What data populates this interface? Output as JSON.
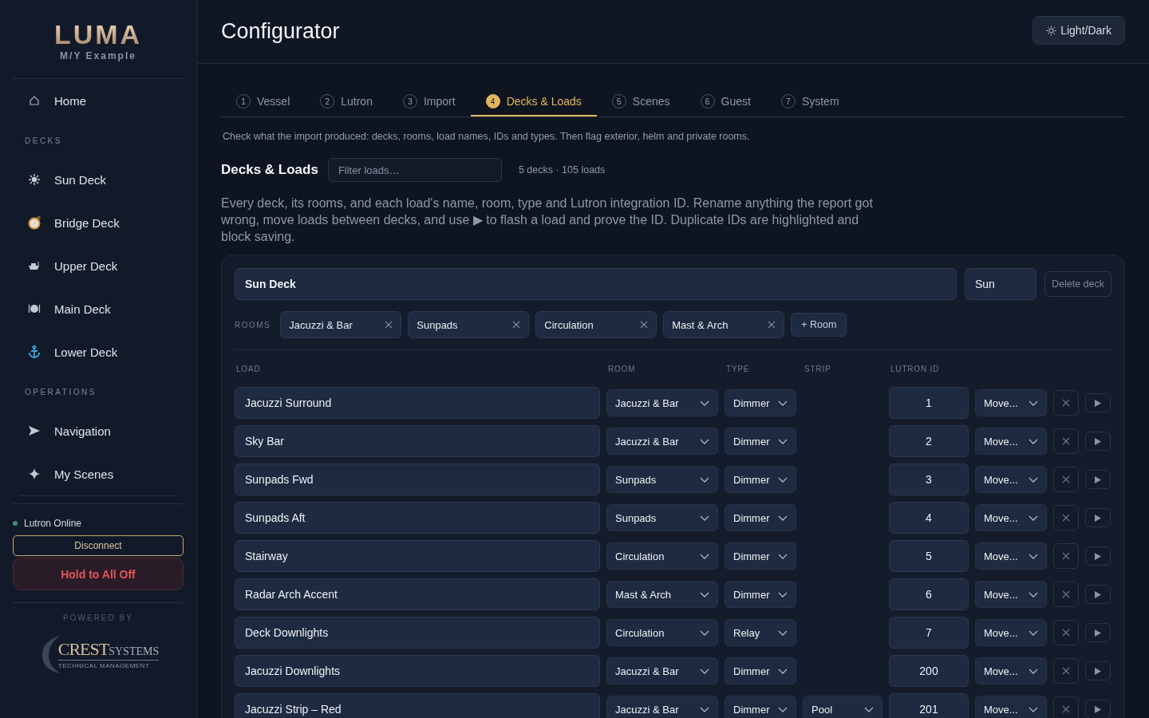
{
  "sidebar": {
    "logo": "LUMA",
    "vessel": "M/Y Example",
    "sections": [
      {
        "items": [
          {
            "label": "Home",
            "kind": "home"
          }
        ]
      },
      {
        "title": "DECKS",
        "items": [
          {
            "label": "Sun Deck",
            "kind": "sun"
          },
          {
            "label": "Bridge Deck",
            "kind": "compass"
          },
          {
            "label": "Upper Deck",
            "kind": "boat"
          },
          {
            "label": "Main Deck",
            "kind": "dish"
          },
          {
            "label": "Lower Deck",
            "kind": "anchor"
          }
        ]
      },
      {
        "title": "OPERATIONS",
        "items": [
          {
            "label": "Navigation",
            "kind": "arrow"
          },
          {
            "label": "My Scenes",
            "kind": "sparkle"
          }
        ]
      }
    ],
    "status": {
      "label": "Lutron Online",
      "color": "#3f8f74"
    },
    "disconnect": "Disconnect",
    "all_off": "Hold to All Off",
    "powered_by": "POWERED BY",
    "partner": {
      "name": "CREST",
      "suffix": "SYSTEMS",
      "tagline": "TECHNICAL MANAGEMENT"
    }
  },
  "header": {
    "title": "Configurator",
    "theme_button": "Light/Dark"
  },
  "tabs": [
    {
      "number": "1",
      "label": "Vessel",
      "selected": false
    },
    {
      "number": "2",
      "label": "Lutron",
      "selected": false
    },
    {
      "number": "3",
      "label": "Import",
      "selected": false
    },
    {
      "number": "4",
      "label": "Decks & Loads",
      "selected": true
    },
    {
      "number": "5",
      "label": "Scenes",
      "selected": false
    },
    {
      "number": "6",
      "label": "Guest",
      "selected": false
    },
    {
      "number": "7",
      "label": "System",
      "selected": false
    }
  ],
  "step_hint": "Check what the import produced: decks, rooms, load names, IDs and types. Then flag exterior, helm and private rooms.",
  "section": {
    "title": "Decks & Loads",
    "filter": {
      "placeholder": "Filter loads…"
    },
    "summary": "5 decks · 105 loads",
    "intro": "Every deck, its rooms, and each load's name, room, type and Lutron integration ID. Rename anything the report got wrong, move loads between decks, and use ▶ to flash a load and prove the ID. Duplicate IDs are highlighted and block saving."
  },
  "deck": {
    "name": "Sun Deck",
    "short": "Sun",
    "delete_button": "Delete deck",
    "rooms_label": "ROOMS",
    "rooms": [
      "Jacuzzi & Bar",
      "Sunpads",
      "Circulation",
      "Mast & Arch"
    ],
    "add_room": "+ Room",
    "columns": [
      "LOAD",
      "ROOM",
      "TYPE",
      "STRIP",
      "LUTRON ID"
    ],
    "loads": [
      {
        "name": "Jacuzzi Surround",
        "room": "Jacuzzi & Bar",
        "type": "Dimmer",
        "id": "1",
        "move": "Move..."
      },
      {
        "name": "Sky Bar",
        "room": "Jacuzzi & Bar",
        "type": "Dimmer",
        "id": "2",
        "move": "Move..."
      },
      {
        "name": "Sunpads Fwd",
        "room": "Sunpads",
        "type": "Dimmer",
        "id": "3",
        "move": "Move..."
      },
      {
        "name": "Sunpads Aft",
        "room": "Sunpads",
        "type": "Dimmer",
        "id": "4",
        "move": "Move..."
      },
      {
        "name": "Stairway",
        "room": "Circulation",
        "type": "Dimmer",
        "id": "5",
        "move": "Move..."
      },
      {
        "name": "Radar Arch Accent",
        "room": "Mast & Arch",
        "type": "Dimmer",
        "id": "6",
        "move": "Move..."
      },
      {
        "name": "Deck Downlights",
        "room": "Circulation",
        "type": "Relay",
        "id": "7",
        "move": "Move..."
      },
      {
        "name": "Jacuzzi Downlights",
        "room": "Jacuzzi & Bar",
        "type": "Dimmer",
        "id": "200",
        "move": "Move..."
      },
      {
        "name": "Jacuzzi Strip – Red",
        "room": "Jacuzzi & Bar",
        "type": "Dimmer",
        "strip": "Pool",
        "id": "201",
        "move": "Move..."
      }
    ]
  }
}
